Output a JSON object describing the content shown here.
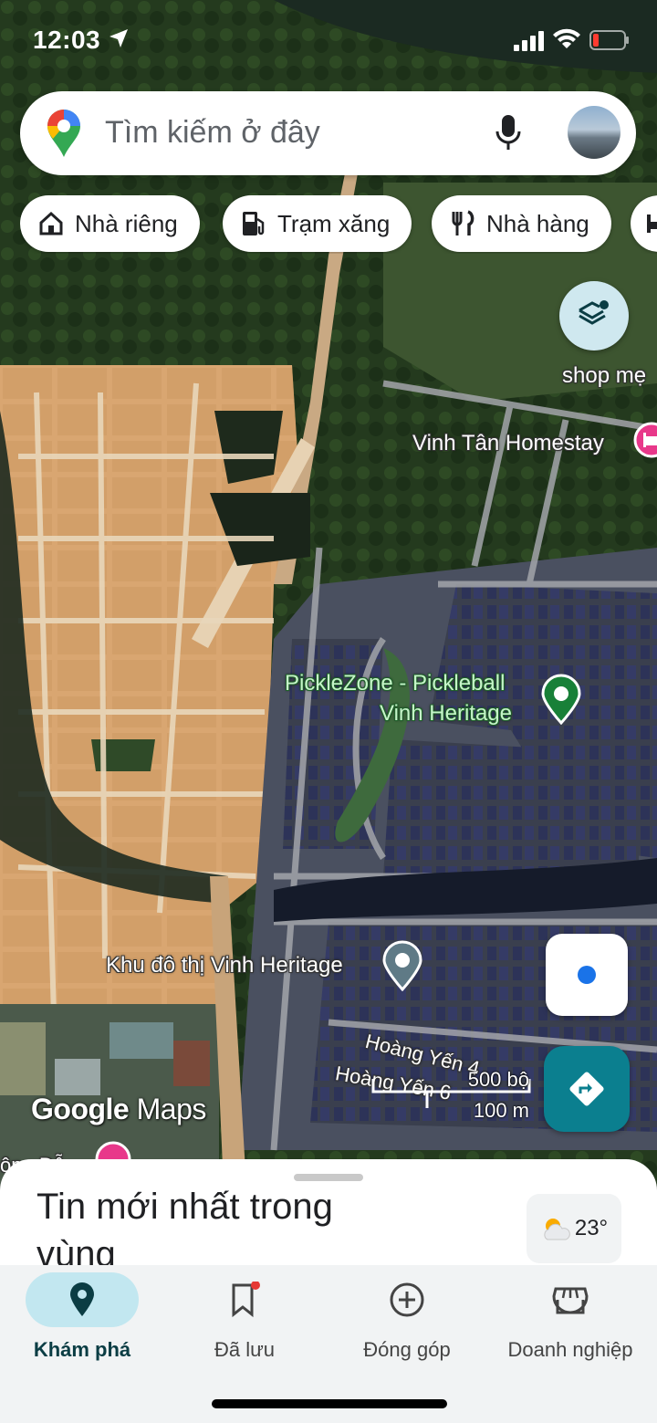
{
  "status_bar": {
    "time": "12:03"
  },
  "search": {
    "placeholder": "Tìm kiếm ở đây"
  },
  "chips": [
    {
      "label": "Nhà riêng",
      "icon": "home-icon"
    },
    {
      "label": "Trạm xăng",
      "icon": "gas-station-icon"
    },
    {
      "label": "Nhà hàng",
      "icon": "restaurant-icon"
    },
    {
      "label": "",
      "icon": "hotel-icon"
    }
  ],
  "map_labels": {
    "shop": "shop mẹ",
    "homestay": "Vinh Tân Homestay",
    "pickle_line1": "PickleZone - Pickleball",
    "pickle_line2": "Vinh Heritage",
    "urban_area": "Khu đô thị Vinh Heritage",
    "street1": "Hoàng Yến 4",
    "street2": "Hoàng Yến 6",
    "bottom_left": "ông Đỗ"
  },
  "watermark": {
    "google": "Google",
    "maps": "Maps"
  },
  "scale": {
    "imperial": "500 bộ",
    "metric": "100 m"
  },
  "sheet": {
    "title": "Tin mới nhất trong vùng"
  },
  "weather": {
    "temp": "23°",
    "icon": "partly-cloudy-icon"
  },
  "nav": [
    {
      "label": "Khám phá",
      "icon": "explore-pin-icon",
      "active": true
    },
    {
      "label": "Đã lưu",
      "icon": "bookmark-icon",
      "active": false
    },
    {
      "label": "Đóng góp",
      "icon": "add-circle-icon",
      "active": false
    },
    {
      "label": "Doanh nghiệp",
      "icon": "storefront-icon",
      "active": false
    }
  ],
  "colors": {
    "accent": "#0b7f8f",
    "active_pill": "#c2e7f0",
    "pin_green": "#188038",
    "pin_pink": "#e8388a"
  }
}
